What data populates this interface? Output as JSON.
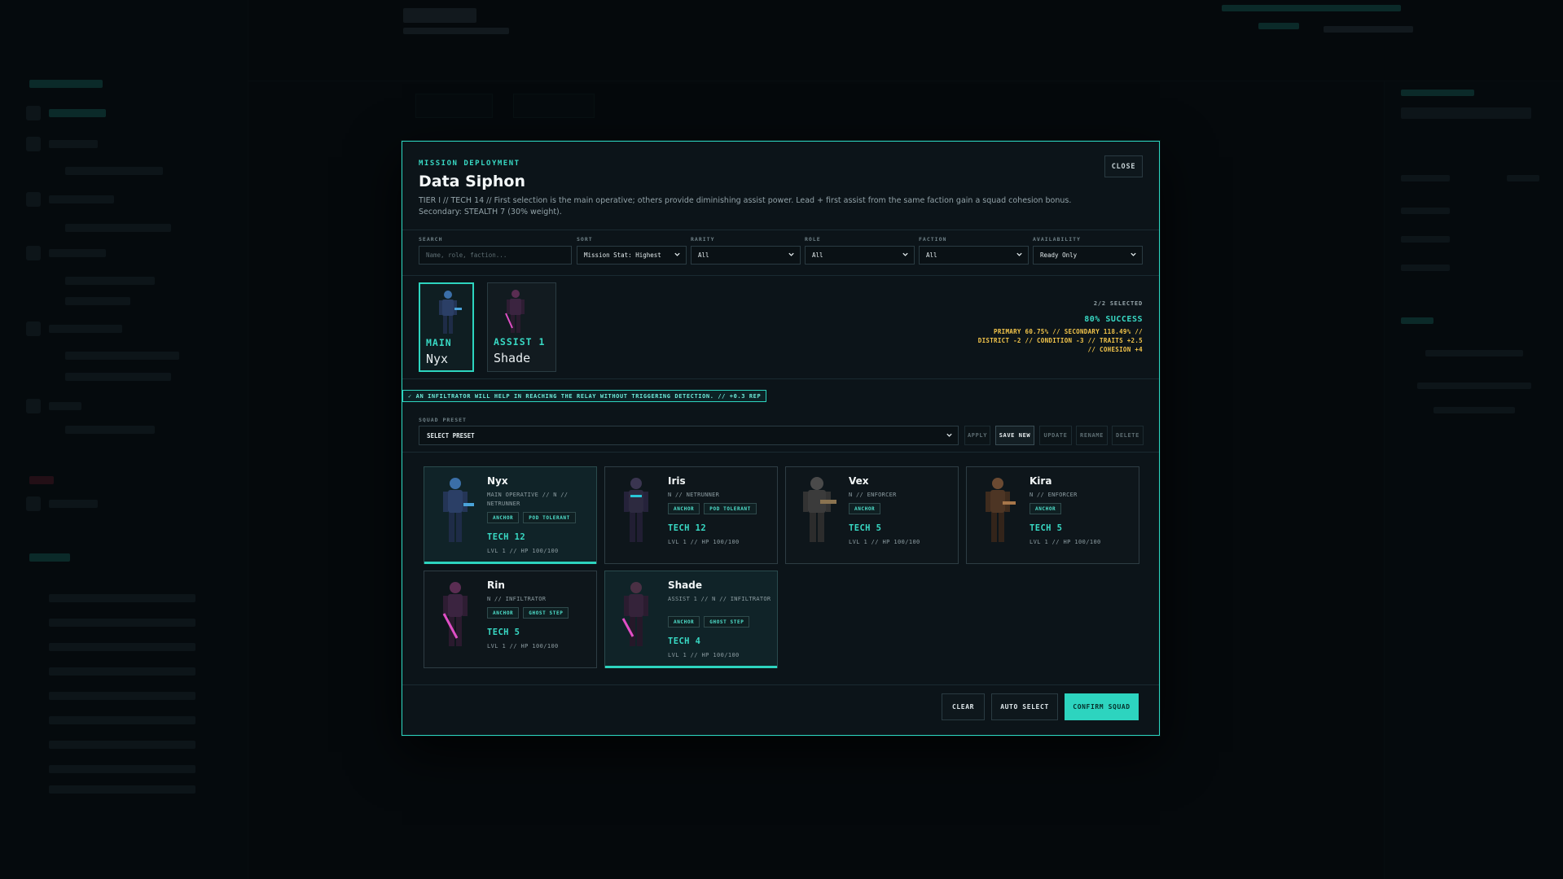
{
  "modal": {
    "eyebrow": "MISSION DEPLOYMENT",
    "title": "Data Siphon",
    "description": "TIER I // TECH 14 // First selection is the main operative; others provide diminishing assist power. Lead + first assist from the same faction gain a squad cohesion bonus. Secondary: STEALTH 7 (30% weight).",
    "close_label": "CLOSE"
  },
  "filters": {
    "search": {
      "label": "SEARCH",
      "placeholder": "Name, role, faction..."
    },
    "sort": {
      "label": "SORT",
      "value": "Mission Stat: Highest"
    },
    "rarity": {
      "label": "RARITY",
      "value": "All"
    },
    "role": {
      "label": "ROLE",
      "value": "All"
    },
    "faction": {
      "label": "FACTION",
      "value": "All"
    },
    "availability": {
      "label": "AVAILABILITY",
      "value": "Ready Only"
    }
  },
  "selection": {
    "slots": [
      {
        "role": "MAIN",
        "name": "Nyx"
      },
      {
        "role": "ASSIST 1",
        "name": "Shade"
      }
    ],
    "count": "2/2 SELECTED",
    "success": "80% SUCCESS",
    "breakdown": "PRIMARY 60.75% // SECONDARY 118.49% // DISTRICT -2 // CONDITION -3 // TRAITS +2.5 // COHESION +4"
  },
  "hint": "✓ AN INFILTRATOR WILL HELP IN REACHING THE RELAY WITHOUT TRIGGERING DETECTION. // +0.3 REP",
  "preset": {
    "label": "SQUAD PRESET",
    "value": "SELECT PRESET",
    "buttons": {
      "apply": "APPLY",
      "save_new": "SAVE NEW",
      "update": "UPDATE",
      "rename": "RENAME",
      "delete": "DELETE"
    }
  },
  "roster": [
    {
      "name": "Nyx",
      "sub": "MAIN OPERATIVE // N // NETRUNNER",
      "tags": [
        "ANCHOR",
        "POD TOLERANT"
      ],
      "stat": "TECH 12",
      "meta": "LVL 1 // HP 100/100"
    },
    {
      "name": "Iris",
      "sub": "N // NETRUNNER",
      "tags": [
        "ANCHOR",
        "POD TOLERANT"
      ],
      "stat": "TECH 12",
      "meta": "LVL 1 // HP 100/100"
    },
    {
      "name": "Vex",
      "sub": "N // ENFORCER",
      "tags": [
        "ANCHOR"
      ],
      "stat": "TECH 5",
      "meta": "LVL 1 // HP 100/100"
    },
    {
      "name": "Kira",
      "sub": "N // ENFORCER",
      "tags": [
        "ANCHOR"
      ],
      "stat": "TECH 5",
      "meta": "LVL 1 // HP 100/100"
    },
    {
      "name": "Rin",
      "sub": "N // INFILTRATOR",
      "tags": [
        "ANCHOR",
        "GHOST STEP"
      ],
      "stat": "TECH 5",
      "meta": "LVL 1 // HP 100/100"
    },
    {
      "name": "Shade",
      "sub": "ASSIST 1 // N // INFILTRATOR",
      "tags": [
        "ANCHOR",
        "GHOST STEP"
      ],
      "stat": "TECH 4",
      "meta": "LVL 1 // HP 100/100"
    }
  ],
  "footer": {
    "clear": "CLEAR",
    "auto_select": "AUTO SELECT",
    "confirm": "CONFIRM SQUAD"
  },
  "colors": {
    "accent": "#2dd4bf",
    "warning": "#f3c54b",
    "background": "#0c1419"
  },
  "icons": {
    "chevron": "chevron-down-icon"
  }
}
